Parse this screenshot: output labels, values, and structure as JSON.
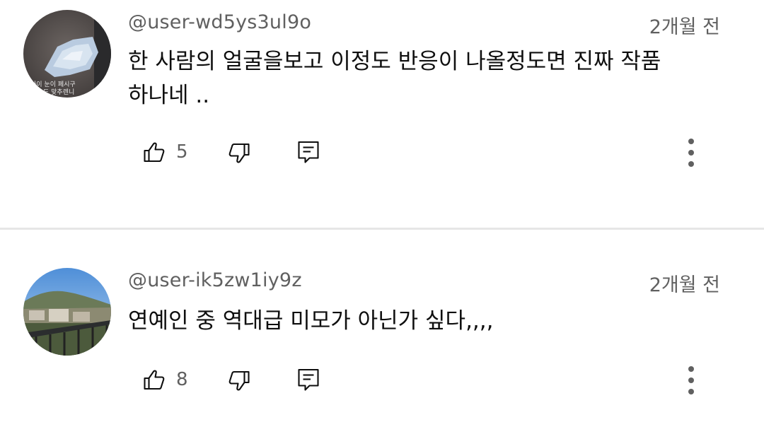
{
  "comments": [
    {
      "author": "@user-wd5ys3ul9o",
      "time": "2개월 전",
      "text": "한 사람의 얼굴을보고 이정도 반응이 나올정도면 진짜 작품\n하나네 ..",
      "likes": "5",
      "avatar_caption": "사이 눈이 페시구\n도 맞추렌니"
    },
    {
      "author": "@user-ik5zw1iy9z",
      "time": "2개월 전",
      "text": "연예인 중 역대급 미모가 아닌가 싶다,,,,",
      "likes": "8"
    }
  ],
  "icons": {
    "like": "thumb-up-icon",
    "dislike": "thumb-down-icon",
    "reply": "reply-icon",
    "more": "more-vert-icon"
  },
  "colors": {
    "text": "#0f0f0f",
    "secondary": "#606060",
    "divider": "#e6e6e6",
    "icon": "#0f0f0f"
  }
}
